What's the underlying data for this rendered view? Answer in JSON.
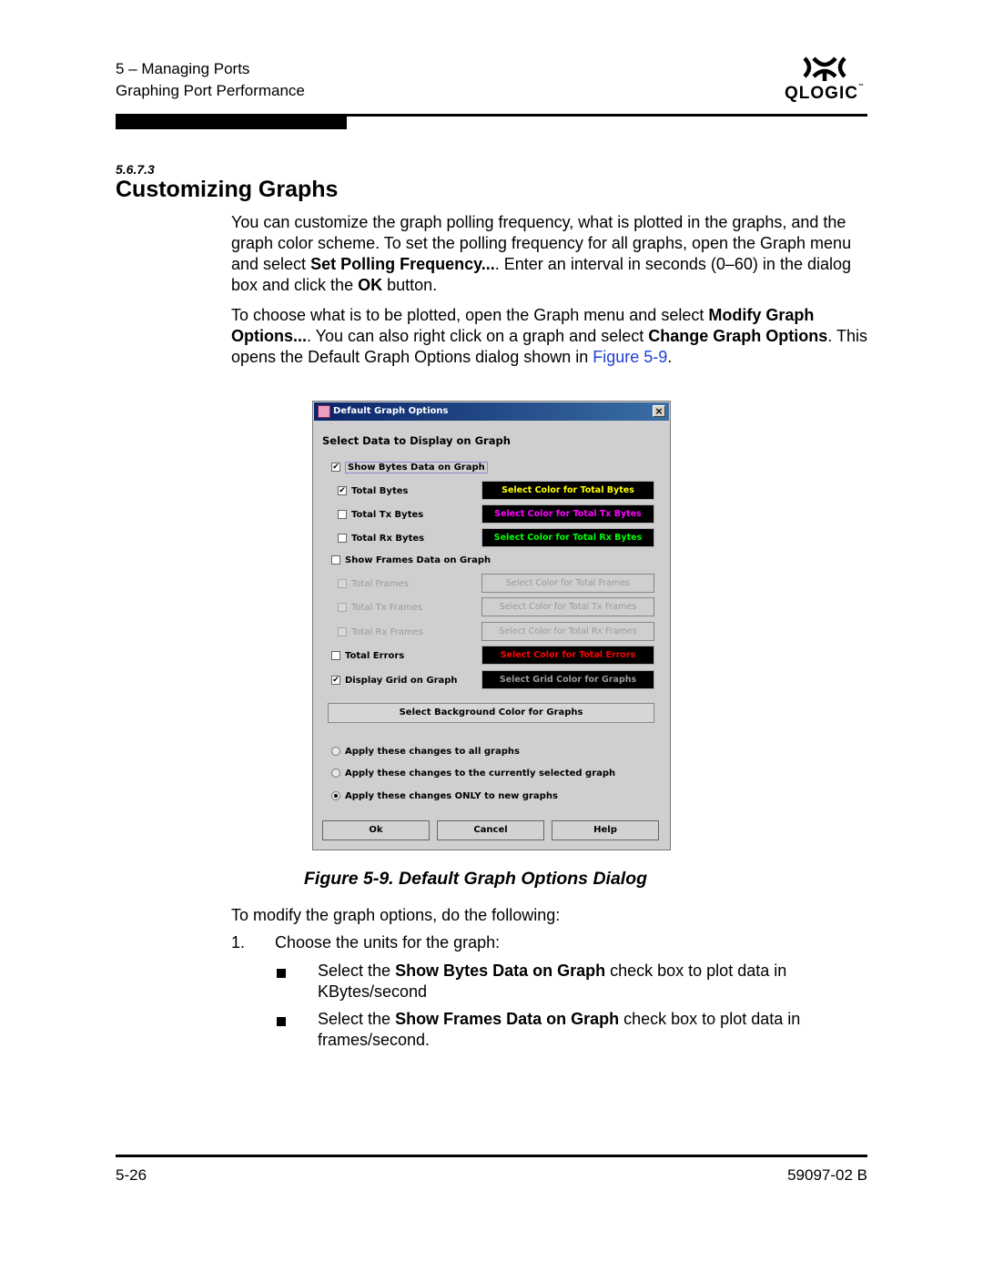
{
  "header": {
    "chapter": "5 – Managing Ports",
    "section": "Graphing Port Performance",
    "logo_text": "QLOGIC",
    "logo_mark": "™"
  },
  "section": {
    "number": "5.6.7.3",
    "title": "Customizing Graphs"
  },
  "paragraphs": {
    "p1": [
      {
        "t": "You can customize the graph polling frequency, what is plotted in the graphs, and the graph color scheme. To set the polling frequency for all graphs, open the Graph menu and select ",
        "b": false
      },
      {
        "t": "Set Polling Frequency...",
        "b": true
      },
      {
        "t": ". Enter an interval in seconds (0–60) in the dialog box and click the ",
        "b": false
      },
      {
        "t": "OK",
        "b": true
      },
      {
        "t": " button.",
        "b": false
      }
    ],
    "p2": [
      {
        "t": "To choose what is to be plotted, open the Graph menu and select ",
        "b": false
      },
      {
        "t": "Modify Graph Options...",
        "b": true
      },
      {
        "t": ". You can also right click on a graph and select ",
        "b": false
      },
      {
        "t": "Change Graph Options",
        "b": true
      },
      {
        "t": ". This opens the Default Graph Options dialog shown in ",
        "b": false
      },
      {
        "t": "Figure 5-9",
        "b": false,
        "link": true
      },
      {
        "t": ".",
        "b": false
      }
    ]
  },
  "dialog": {
    "title": "Default Graph Options",
    "close_label": "×",
    "heading": "Select Data to Display on Graph",
    "options": [
      {
        "label": "Show Bytes Data on Graph",
        "checked": true,
        "enabled": true
      },
      {
        "label": "Total Bytes",
        "checked": true,
        "enabled": true,
        "button": "Select Color for Total Bytes",
        "color": "#ffff00",
        "black": true
      },
      {
        "label": "Total Tx Bytes",
        "checked": false,
        "enabled": true,
        "button": "Select Color for Total Tx Bytes",
        "color": "#ff00ff",
        "black": true
      },
      {
        "label": "Total Rx Bytes",
        "checked": false,
        "enabled": true,
        "button": "Select Color for Total Rx Bytes",
        "color": "#00ff00",
        "black": true
      },
      {
        "label": "Show Frames Data on Graph",
        "checked": false,
        "enabled": true
      },
      {
        "label": "Total Frames",
        "checked": false,
        "enabled": false,
        "button": "Select Color for Total Frames"
      },
      {
        "label": "Total Tx Frames",
        "checked": false,
        "enabled": false,
        "button": "Select Color for Total Tx Frames"
      },
      {
        "label": "Total Rx Frames",
        "checked": false,
        "enabled": false,
        "button": "Select Color for Total Rx Frames"
      },
      {
        "label": "Total Errors",
        "checked": false,
        "enabled": true,
        "button": "Select Color for Total Errors",
        "color": "#ff0000",
        "black": true
      },
      {
        "label": "Display Grid on Graph",
        "checked": true,
        "enabled": true,
        "button": "Select Grid Color for Graphs",
        "color": "#9a9a9a",
        "black": true
      }
    ],
    "background_button": "Select Background Color for Graphs",
    "radios": [
      {
        "label": "Apply these changes to all graphs",
        "selected": false
      },
      {
        "label": "Apply these changes to the currently selected graph",
        "selected": false
      },
      {
        "label": "Apply these changes ONLY to new graphs",
        "selected": true
      }
    ],
    "buttons": {
      "ok": "Ok",
      "cancel": "Cancel",
      "help": "Help"
    }
  },
  "figure_caption": "Figure 5-9.  Default Graph Options Dialog",
  "steps": {
    "intro": "To modify the graph options, do the following:",
    "step1_num": "1.",
    "step1_text": "Choose the units for the graph:",
    "bullets": [
      [
        {
          "t": "Select the ",
          "b": false
        },
        {
          "t": "Show Bytes Data on Graph",
          "b": true
        },
        {
          "t": " check box to plot data in KBytes/second",
          "b": false
        }
      ],
      [
        {
          "t": "Select the ",
          "b": false
        },
        {
          "t": "Show Frames Data on Graph",
          "b": true
        },
        {
          "t": " check box to plot data in frames/second.",
          "b": false
        }
      ]
    ]
  },
  "footer": {
    "page": "5-26",
    "doc": "59097-02 B"
  }
}
